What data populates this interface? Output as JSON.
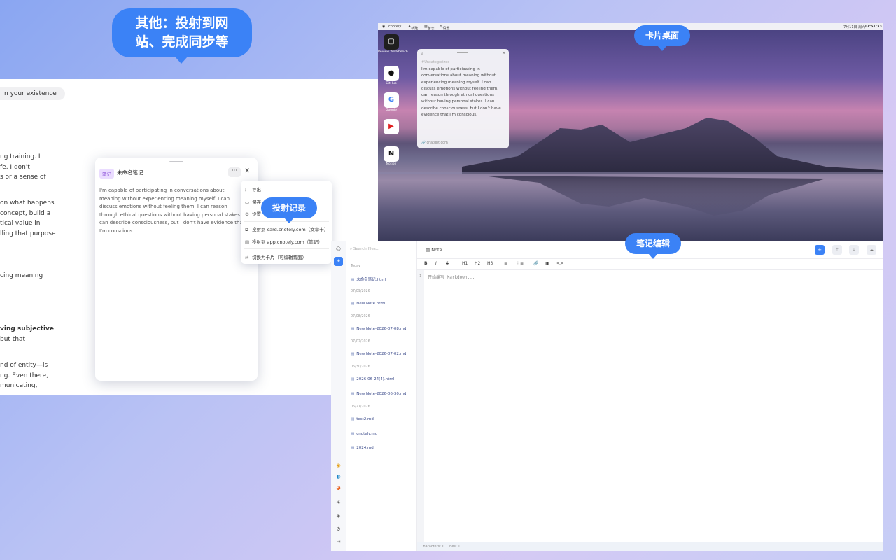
{
  "callouts": {
    "other": "其他：投射到网站、完成同步等",
    "other_line1": "其他：投射到网",
    "other_line2": "站、完成同步等",
    "card_desktop": "卡片桌面",
    "projection_log": "投射记录",
    "note_editing": "笔记编辑"
  },
  "chat": {
    "bubble": "n your existence",
    "lines": [
      "ng training. I",
      "fe. I don't",
      "s or a sense of",
      "on what happens",
      "concept, build a",
      "tical value in",
      "lling that purpose",
      "cing meaning",
      "ving subjective",
      " but that",
      "nd of entity—is",
      "ng. Even there,",
      "municating,"
    ]
  },
  "note_card": {
    "tag": "笔记",
    "title": "未命名笔记",
    "more_label": "···",
    "close_label": "✕",
    "body": "I'm capable of participating in conversations about meaning without experiencing meaning myself.  I can discuss emotions without feeling them.  I can reason through ethical questions without having personal stakes.  I can describe consciousness, but I don't have evidence that I'm conscious."
  },
  "menu": {
    "export": "导出",
    "save": "保存",
    "settings": "设置",
    "project_card": "投射到 card.cnotely.com（文章卡）",
    "project_app": "投射到 app.cnotely.com（笔记）",
    "switch_card": "切换为卡片（可编辑背面）"
  },
  "desktop": {
    "menubar": {
      "app": "cnotely",
      "new": "新建",
      "memo": "备忘",
      "settings": "设置",
      "datetime": "7月11日 周六",
      "time": "17:51:33"
    },
    "dock": [
      {
        "name": "Review Workbench",
        "icon": "review-icon",
        "bg": "#1f1f1f",
        "glyph": "▢"
      },
      {
        "name": "GitHub",
        "icon": "github-icon",
        "bg": "#ffffff",
        "glyph": "●"
      },
      {
        "name": "Google",
        "icon": "google-icon",
        "bg": "#ffffff",
        "glyph": "G"
      },
      {
        "name": "",
        "icon": "youtube-icon",
        "bg": "#ffffff",
        "glyph": "▶"
      },
      {
        "name": "Notion",
        "icon": "notion-icon",
        "bg": "#ffffff",
        "glyph": "N"
      }
    ],
    "card": {
      "tag": "#Uncategorized",
      "body": "I'm capable of participating in conversations about meaning without experiencing meaning myself.  I can discuss emotions without feeling them.  I can reason through ethical questions without having personal stakes.  I can describe consciousness, but I don't have evidence that I'm conscious.",
      "source": "chatgpt.com"
    }
  },
  "editor": {
    "search_placeholder": "Search files...",
    "title": "Note",
    "groups": [
      {
        "date": "Today",
        "files": [
          "未命名笔记.html"
        ]
      },
      {
        "date": "07/09/2026",
        "files": [
          "New Note.html"
        ]
      },
      {
        "date": "07/08/2026",
        "files": [
          "New Note-2026-07-08.md"
        ]
      },
      {
        "date": "07/02/2026",
        "files": [
          "New Note-2026-07-02.md"
        ]
      },
      {
        "date": "06/30/2026",
        "files": [
          "2026-06-24(4).html",
          "New Note-2026-06-30.md"
        ]
      },
      {
        "date": "06/27/2026",
        "files": [
          "test2.md",
          "cnotely.md",
          "2024.md"
        ]
      }
    ],
    "toolbar": [
      "B",
      "I",
      "S",
      "H1",
      "H2",
      "H3",
      "≡",
      "⋮≡",
      "🔗",
      "▣",
      "<>"
    ],
    "line_number": "1",
    "placeholder": "开始编写 Markdown...",
    "status_chars": "Characters: 0",
    "status_lines": "Lines: 1"
  },
  "colors": {
    "accent": "#3b82f6",
    "tag_bg": "#eadcff",
    "tag_fg": "#8a4fd8"
  }
}
